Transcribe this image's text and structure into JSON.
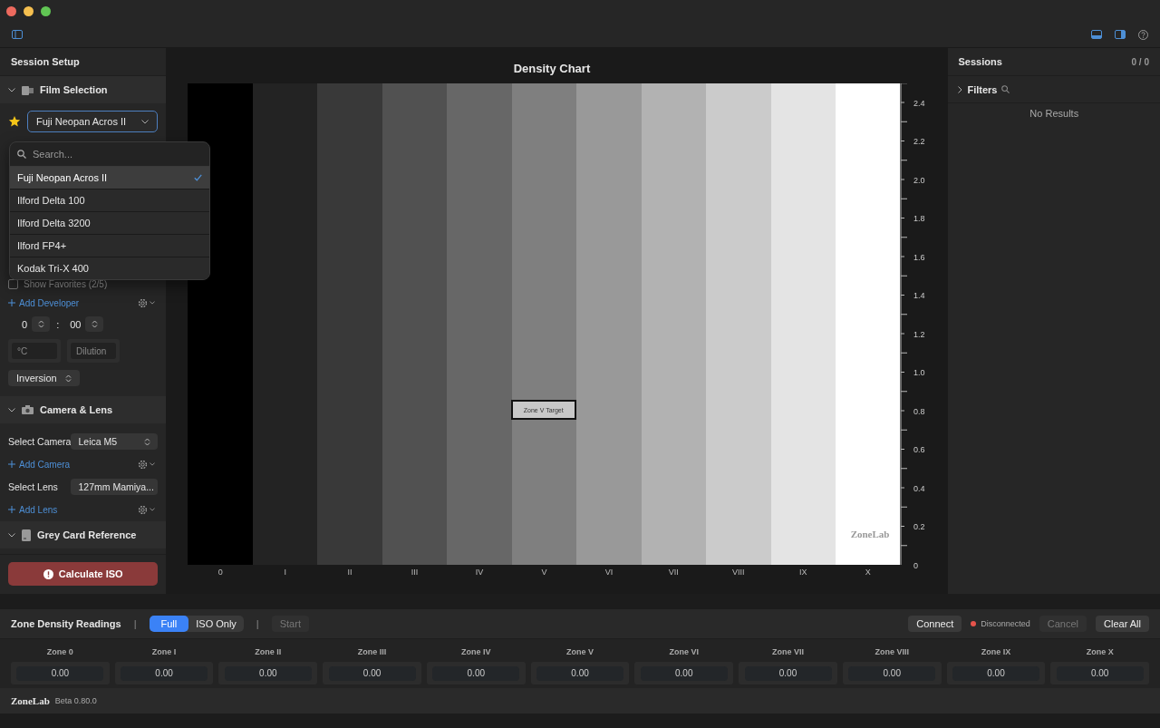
{
  "sidebar": {
    "title": "Session Setup",
    "film": {
      "header": "Film Selection",
      "expanded": true,
      "favorite": true,
      "selected_film": "Fuji Neopan Acros II",
      "show_favorites": {
        "label": "Show Favorites (2/5)",
        "checked": false
      },
      "add_developer": "Add Developer",
      "time": {
        "minutes": "0",
        "separator": ":",
        "seconds": "00"
      },
      "temperature": {
        "placeholder": "°C"
      },
      "dilution": {
        "placeholder": "Dilution"
      },
      "agitation": "Inversion"
    },
    "camera": {
      "header": "Camera & Lens",
      "expanded": true,
      "camera_label": "Select Camera",
      "camera": "Leica M5",
      "add_camera": "Add Camera",
      "lens_label": "Select Lens",
      "lens": "127mm Mamiya...",
      "add_lens": "Add Lens"
    },
    "grey_card": {
      "header": "Grey Card Reference",
      "expanded": true
    },
    "calculate_button": "Calculate ISO"
  },
  "film_dropdown": {
    "search": {
      "placeholder": "Search..."
    },
    "options": [
      {
        "label": "Fuji Neopan Acros II",
        "selected": true
      },
      {
        "label": "Ilford Delta 100",
        "selected": false
      },
      {
        "label": "Ilford Delta 3200",
        "selected": false
      },
      {
        "label": "Ilford FP4+",
        "selected": false
      },
      {
        "label": "Kodak Tri-X 400",
        "selected": false
      }
    ]
  },
  "chart": {
    "title": "Density Chart",
    "target_label": "Zone V Target",
    "watermark": "ZoneLab",
    "zones": [
      {
        "label": "0",
        "color": "#000000",
        "target": false
      },
      {
        "label": "I",
        "color": "#232323",
        "target": false
      },
      {
        "label": "II",
        "color": "#393939",
        "target": false
      },
      {
        "label": "III",
        "color": "#515151",
        "target": false
      },
      {
        "label": "IV",
        "color": "#676767",
        "target": false
      },
      {
        "label": "V",
        "color": "#7f7f7f",
        "target": true
      },
      {
        "label": "VI",
        "color": "#999999",
        "target": false
      },
      {
        "label": "VII",
        "color": "#b2b2b2",
        "target": false
      },
      {
        "label": "VIII",
        "color": "#cbcbcb",
        "target": false
      },
      {
        "label": "IX",
        "color": "#e4e4e4",
        "target": false
      },
      {
        "label": "X",
        "color": "#ffffff",
        "target": false
      }
    ],
    "y_ticks": [
      "2.4",
      "2.2",
      "2.0",
      "1.8",
      "1.6",
      "1.4",
      "1.2",
      "1.0",
      "0.8",
      "0.6",
      "0.4",
      "0.2",
      "0"
    ]
  },
  "sessions": {
    "title": "Sessions",
    "count": "0 / 0",
    "filters": {
      "label": "Filters",
      "expanded": false
    },
    "empty": "No Results"
  },
  "readings": {
    "title": "Zone Density Readings",
    "separators": [
      "|",
      "|"
    ],
    "modes": [
      {
        "label": "Full",
        "selected": true
      },
      {
        "label": "ISO Only",
        "selected": false
      }
    ],
    "start": {
      "label": "Start",
      "disabled": true
    },
    "connect": "Connect",
    "status": {
      "label": "Disconnected",
      "color": "#e5534b"
    },
    "cancel": {
      "label": "Cancel",
      "disabled": true
    },
    "clear": "Clear All",
    "zones": [
      {
        "label": "Zone 0",
        "value": "0.00"
      },
      {
        "label": "Zone I",
        "value": "0.00"
      },
      {
        "label": "Zone II",
        "value": "0.00"
      },
      {
        "label": "Zone III",
        "value": "0.00"
      },
      {
        "label": "Zone IV",
        "value": "0.00"
      },
      {
        "label": "Zone V",
        "value": "0.00"
      },
      {
        "label": "Zone VI",
        "value": "0.00"
      },
      {
        "label": "Zone VII",
        "value": "0.00"
      },
      {
        "label": "Zone VIII",
        "value": "0.00"
      },
      {
        "label": "Zone IX",
        "value": "0.00"
      },
      {
        "label": "Zone X",
        "value": "0.00"
      }
    ]
  },
  "footer": {
    "logo": "ZoneLab",
    "version": "Beta 0.80.0"
  }
}
